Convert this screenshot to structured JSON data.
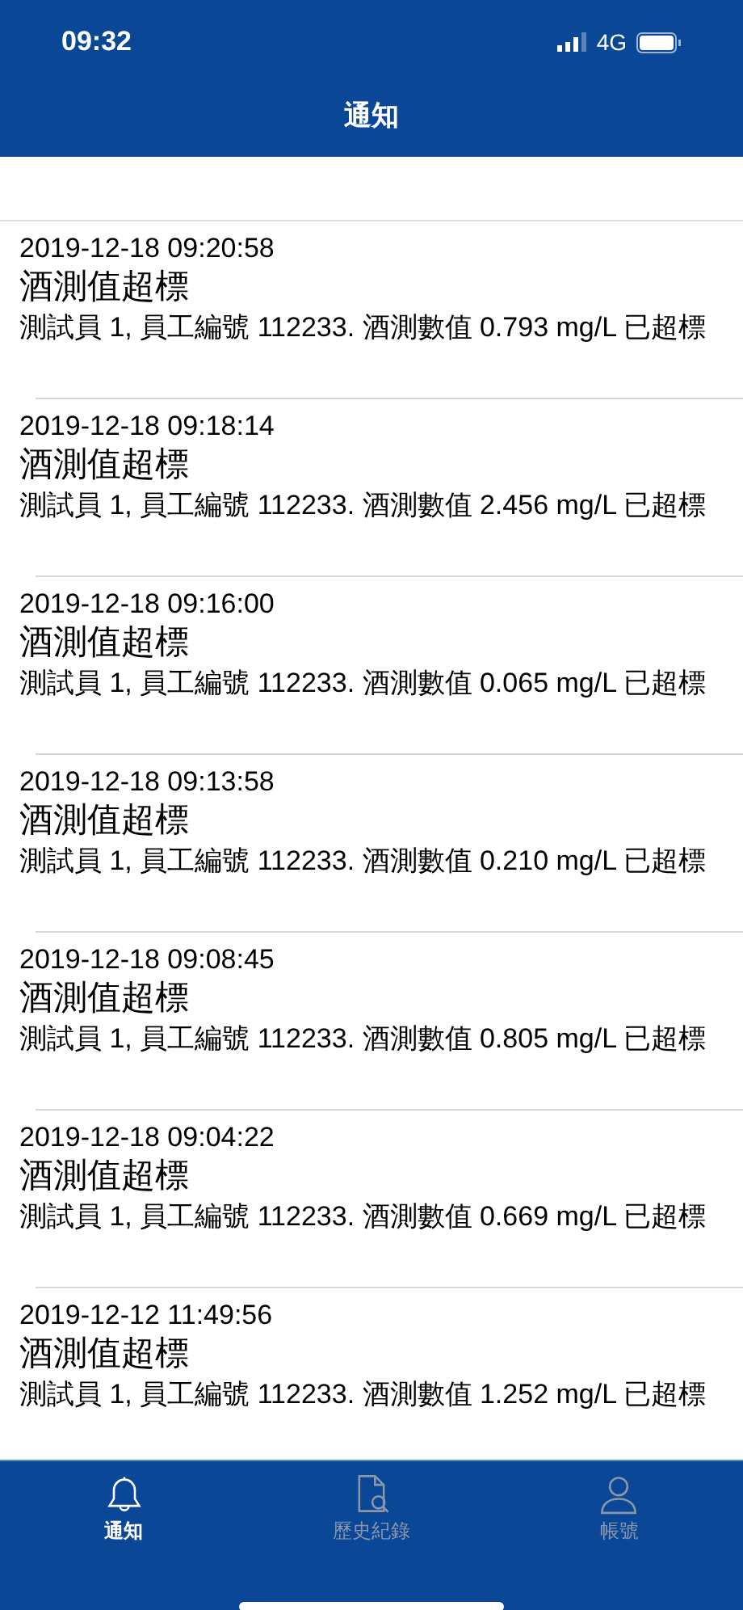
{
  "status_bar": {
    "time": "09:32",
    "network": "4G"
  },
  "nav_bar": {
    "title": "通知"
  },
  "notifications": [
    {
      "time": "2019-12-18 09:20:58",
      "title": "酒測值超標",
      "message": "測試員 1, 員工編號 112233. 酒測數值 0.793 mg/L 已超標"
    },
    {
      "time": "2019-12-18 09:18:14",
      "title": "酒測值超標",
      "message": "測試員 1, 員工編號 112233. 酒測數值 2.456 mg/L 已超標"
    },
    {
      "time": "2019-12-18 09:16:00",
      "title": "酒測值超標",
      "message": "測試員 1, 員工編號 112233. 酒測數值 0.065 mg/L 已超標"
    },
    {
      "time": "2019-12-18 09:13:58",
      "title": "酒測值超標",
      "message": "測試員 1, 員工編號 112233. 酒測數值 0.210 mg/L 已超標"
    },
    {
      "time": "2019-12-18 09:08:45",
      "title": "酒測值超標",
      "message": "測試員 1, 員工編號 112233. 酒測數值 0.805 mg/L 已超標"
    },
    {
      "time": "2019-12-18 09:04:22",
      "title": "酒測值超標",
      "message": "測試員 1, 員工編號 112233. 酒測數值 0.669 mg/L 已超標"
    },
    {
      "time": "2019-12-12 11:49:56",
      "title": "酒測值超標",
      "message": "測試員 1, 員工編號 112233. 酒測數值 1.252 mg/L 已超標"
    }
  ],
  "tab_bar": [
    {
      "kind": "bell",
      "label": "通知",
      "selected": true
    },
    {
      "kind": "document",
      "label": "歷史紀錄",
      "selected": false
    },
    {
      "kind": "person",
      "label": "帳號",
      "selected": false
    }
  ]
}
